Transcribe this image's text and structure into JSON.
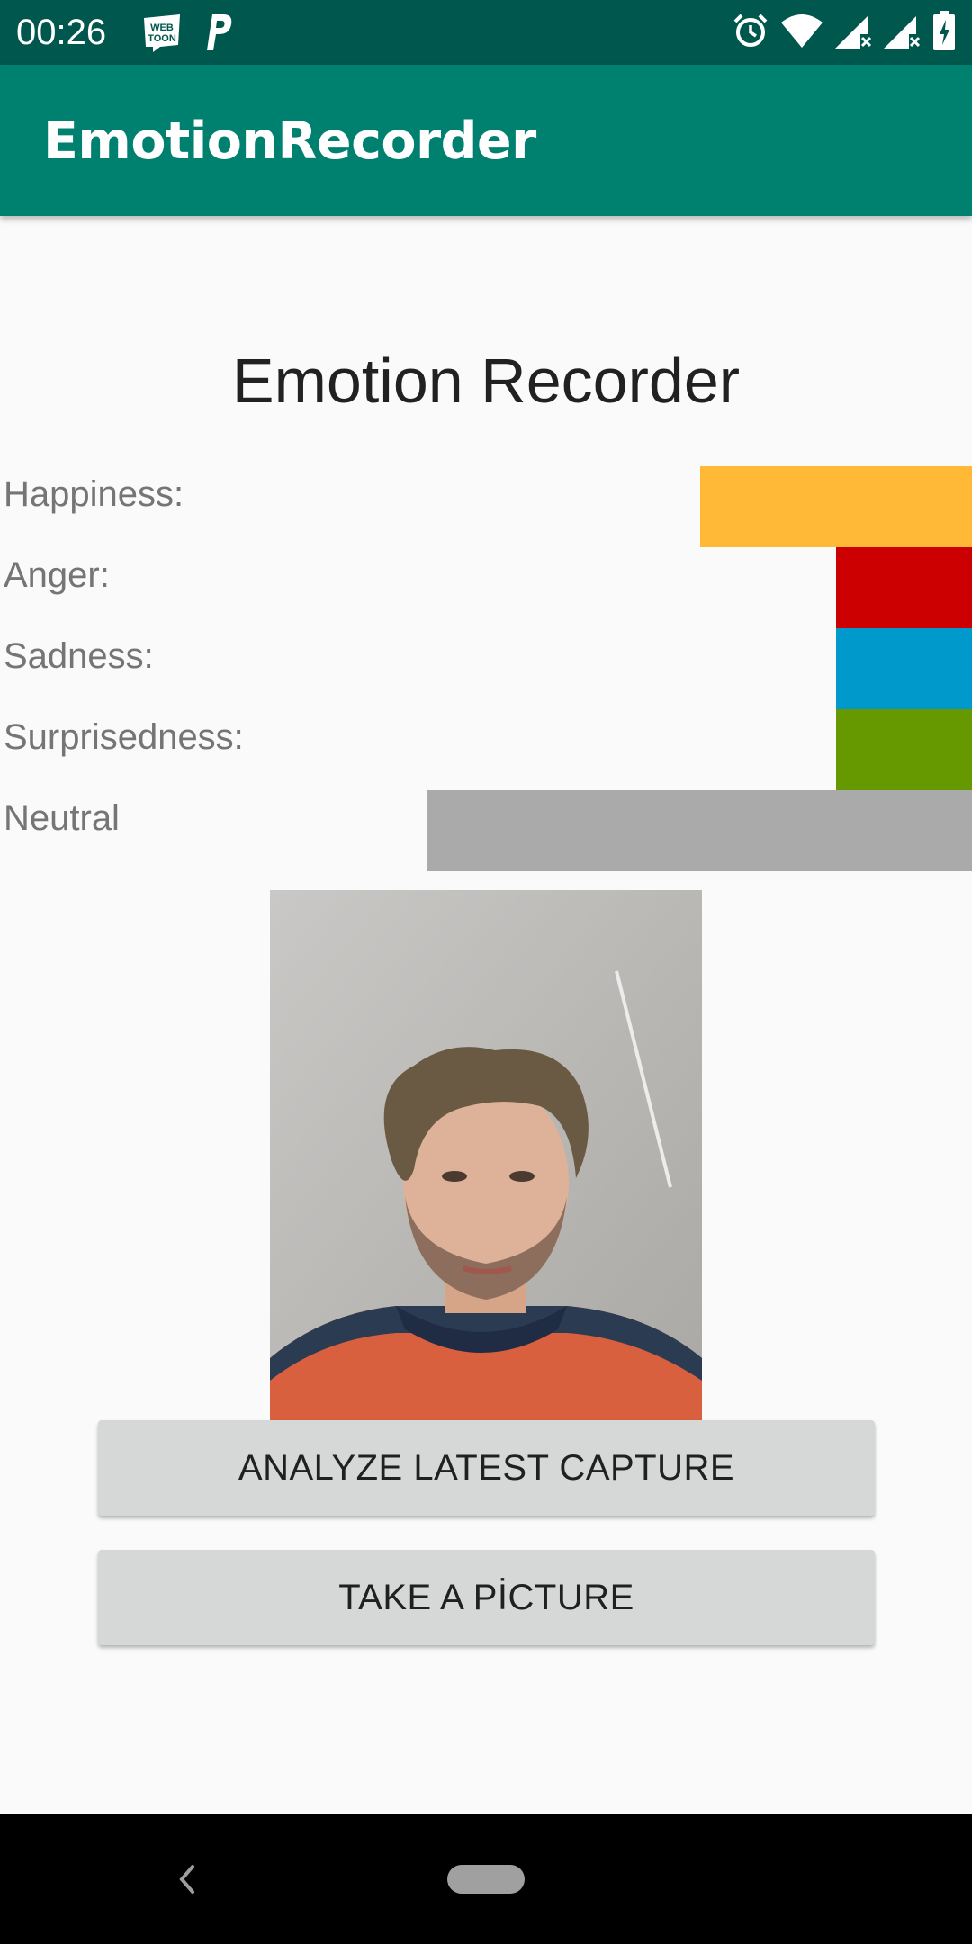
{
  "status_bar": {
    "time": "00:26",
    "left_icons": [
      "webtoon-icon",
      "p-icon"
    ],
    "right_icons": [
      "alarm-icon",
      "wifi-icon",
      "signal-icon",
      "signal-icon",
      "battery-icon"
    ],
    "webtoon_logo_text": "WEB TOON"
  },
  "app_bar": {
    "title": "EmotionRecorder",
    "color": "#00806f"
  },
  "main": {
    "title": "Emotion Recorder",
    "emotions": [
      {
        "label": "Happiness:",
        "color": "#ffb937",
        "fraction": 0.28
      },
      {
        "label": "Anger:",
        "color": "#cc0000",
        "fraction": 0.14
      },
      {
        "label": "Sadness:",
        "color": "#0099cc",
        "fraction": 0.14
      },
      {
        "label": "Surprisedness:",
        "color": "#669900",
        "fraction": 0.14
      },
      {
        "label": "Neutral",
        "color": "#aaaaaa",
        "fraction": 0.56
      }
    ]
  },
  "buttons": {
    "analyze_label": "ANALYZE LATEST CAPTURE",
    "take_picture_label": "TAKE A PİCTURE"
  },
  "nav_bar": {
    "icons": [
      "back-icon",
      "home-pill-icon"
    ]
  }
}
